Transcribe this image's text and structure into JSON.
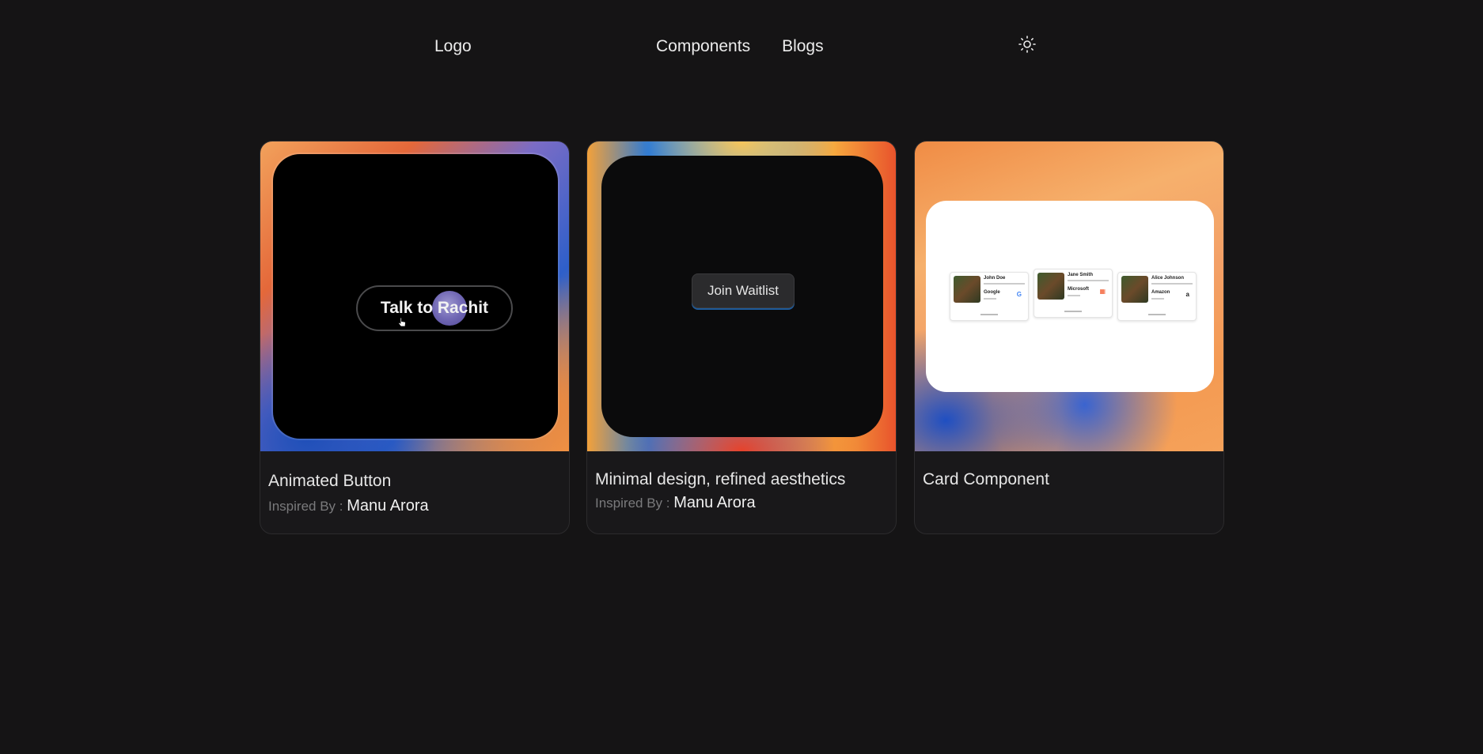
{
  "header": {
    "logo": "Logo",
    "nav": [
      "Components",
      "Blogs"
    ],
    "theme_toggle_icon": "sun-icon"
  },
  "cards": [
    {
      "title": "Animated Button",
      "credit_prefix": "Inspired By :",
      "author": "Manu Arora",
      "preview": {
        "button_label": "Talk to Rachit"
      }
    },
    {
      "title": "Minimal design, refined aesthetics",
      "credit_prefix": "Inspired By :",
      "author": "Manu Arora",
      "preview": {
        "button_label": "Join Waitlist"
      }
    },
    {
      "title": "Card Component",
      "preview": {
        "people": [
          {
            "name": "John Doe",
            "company": "Google",
            "company_mark": "G"
          },
          {
            "name": "Jane Smith",
            "company": "Microsoft",
            "company_mark": "▦"
          },
          {
            "name": "Alice Johnson",
            "company": "Amazon",
            "company_mark": "a"
          }
        ]
      }
    }
  ],
  "colors": {
    "background": "#151415",
    "card_border": "#2c2b2d",
    "text": "#e6e6e6",
    "muted": "#7a7a7c"
  }
}
